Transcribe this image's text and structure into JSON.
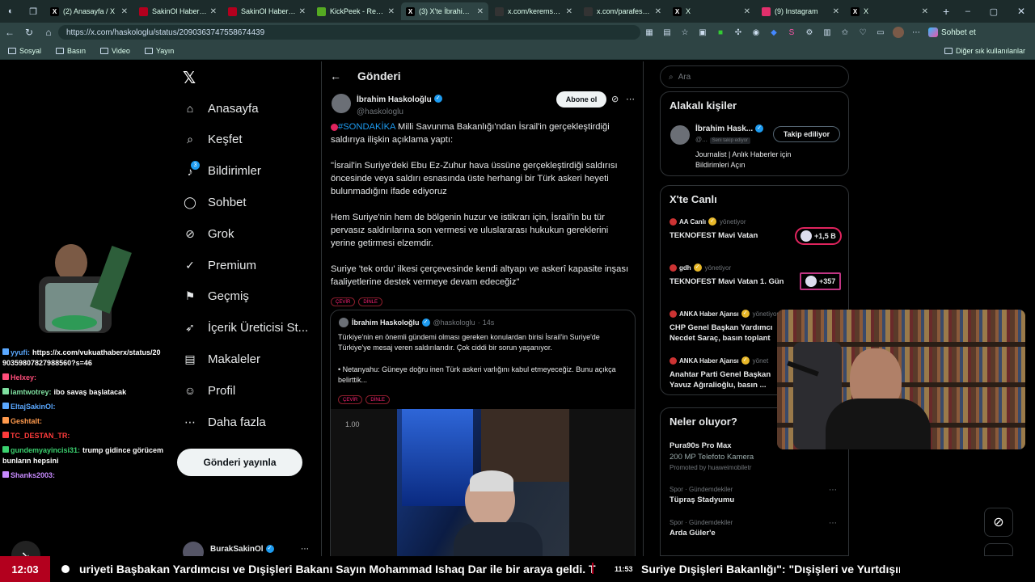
{
  "browser": {
    "tabs": [
      {
        "label": "(2) Anasayfa / X",
        "icon": "x-logo-icon"
      },
      {
        "label": "SakinOl Haber Merk",
        "icon": "tab-favicon"
      },
      {
        "label": "SakinOl Haber Merk",
        "icon": "tab-favicon"
      },
      {
        "label": "KickPeek - Real-time",
        "icon": "tab-favicon"
      },
      {
        "label": "(3) X'te İbrahim Has",
        "icon": "x-logo-icon",
        "active": true
      },
      {
        "label": "x.com/keremsackay",
        "icon": "tab-favicon"
      },
      {
        "label": "x.com/parafesorfina",
        "icon": "tab-favicon"
      },
      {
        "label": "X",
        "icon": "x-logo-icon"
      },
      {
        "label": "(9) Instagram",
        "icon": "instagram-icon"
      },
      {
        "label": "X",
        "icon": "x-logo-icon"
      }
    ],
    "url": "https://x.com/haskologlu/status/2090363747558674439",
    "profile_label": "Sohbet et",
    "bookmarks": [
      "Sosyal",
      "Basın",
      "Video",
      "Yayın"
    ],
    "other_bookmarks": "Diğer sık kullanılanlar"
  },
  "sidebar": {
    "items": [
      {
        "label": "Anasayfa",
        "icon": "home-icon"
      },
      {
        "label": "Keşfet",
        "icon": "search-icon"
      },
      {
        "label": "Bildirimler",
        "icon": "bell-icon",
        "badge": "3"
      },
      {
        "label": "Sohbet",
        "icon": "chat-icon"
      },
      {
        "label": "Grok",
        "icon": "grok-icon"
      },
      {
        "label": "Premium",
        "icon": "premium-icon"
      },
      {
        "label": "Geçmiş",
        "icon": "bookmark-icon"
      },
      {
        "label": "İçerik Üreticisi St...",
        "icon": "rocket-icon"
      },
      {
        "label": "Makaleler",
        "icon": "article-icon"
      },
      {
        "label": "Profil",
        "icon": "person-icon"
      },
      {
        "label": "Daha fazla",
        "icon": "more-icon"
      }
    ],
    "post_button": "Gönderi yayınla",
    "account_name": "BurakSakinOl"
  },
  "main": {
    "header_title": "Gönderi",
    "author_name": "İbrahim Haskoloğlu",
    "author_handle": "@haskologlu",
    "subscribe_label": "Abone ol",
    "hashtag": "#SONDAKİKA",
    "paragraph1": "Milli Savunma Bakanlığı'ndan İsrail'in gerçekleştirdiği saldırıya ilişkin açıklama yaptı:",
    "paragraph2": "\"İsrail'in Suriye'deki Ebu Ez-Zuhur hava üssüne gerçekleştirdiği saldırısı öncesinde veya saldırı esnasında üste herhangi bir Türk askeri heyeti bulunmadığını ifade ediyoruz",
    "paragraph3": "Hem Suriye'nin hem de bölgenin huzur ve istikrarı için, İsrail'in bu tür pervasız saldırılarına son vermesi ve uluslararası hukukun gereklerini yerine getirmesi elzemdir.",
    "paragraph4": "Suriye 'tek ordu' ilkesi çerçevesinde kendi altyapı ve askerî kapasite inşası faaliyetlerine destek vermeye devam edeceğiz\"",
    "pill_translate": "ÇEVİR",
    "pill_listen": "DİNLE",
    "quote": {
      "author": "İbrahim Haskoloğlu",
      "handle": "@haskologlu",
      "time": "14s",
      "text1": "Türkiye'nin en önemli gündemi olması gereken konulardan birisi İsrail'in Suriye'de Türkiye'ye mesaj veren saldırılarıdır. Çok ciddi bir sorun yaşanıyor.",
      "text2": "• Netanyahu:  Güneye doğru inen Türk askeri varlığını kabul etmeyeceğiz. Bunu açıkça belirttik...",
      "video_time": "1.00"
    }
  },
  "right": {
    "search_placeholder": "Ara",
    "related_title": "Alakalı kişiler",
    "related_name": "İbrahim Hask...",
    "related_handle": "@...",
    "related_follows": "Seni takip ediyor",
    "related_follow_btn": "Takip ediliyor",
    "related_bio": "Journalist | Anlık Haberler için Bildirimleri Açın",
    "live_title": "X'te Canlı",
    "live": [
      {
        "host": "AA Canlı",
        "status": "yönetiyor",
        "title": "TEKNOFEST Mavi Vatan",
        "count": "+1,5 B"
      },
      {
        "host": "gdh",
        "status": "yönetiyor",
        "title": "TEKNOFEST Mavi Vatan 1. Gün",
        "count": "+357"
      },
      {
        "host": "ANKA Haber Ajansı",
        "status": "yönetiyor",
        "title": "CHP Genel Başkan Yardımcı Necdet Saraç, basın toplant",
        "count": ""
      },
      {
        "host": "ANKA Haber Ajansı",
        "status": "yönet",
        "title": "Anahtar Parti Genel Başkan Yavuz Ağıralioğlu, basın ...",
        "count": ""
      }
    ],
    "whats_title": "Neler oluyor?",
    "trends": [
      {
        "meta": "",
        "name": "Pura90s Pro Max",
        "sub": "200 MP Telefoto Kamera",
        "promo": "Promoted by huaweimobiletr"
      },
      {
        "meta": "Spor · Gündemdekiler",
        "name": "Tüpraş Stadyumu",
        "sub": "",
        "promo": ""
      },
      {
        "meta": "Spor · Gündemdekiler",
        "name": "Arda Güler'e",
        "sub": "",
        "promo": ""
      }
    ]
  },
  "chat": [
    {
      "user": "yyufi:",
      "text": "https://x.com/vukuathaberx/status/2090359807827988560?s=46",
      "color": "#5aa8ff"
    },
    {
      "user": "Helxey:",
      "text": "",
      "color": "#ff4d7a"
    },
    {
      "user": "iamtwotrey:",
      "text": "ibo savaş başlatacak",
      "color": "#7fe0a0"
    },
    {
      "user": "EltajSakinOl:",
      "text": "",
      "color": "#5aa8ff"
    },
    {
      "user": "Geshtalt:",
      "text": "",
      "color": "#ff9a4d"
    },
    {
      "user": "TC_DESTAN_TR:",
      "text": "",
      "color": "#ff3b3b"
    },
    {
      "user": "gundemyayincisi31:",
      "text": "trump gidince görücem bunların hepsini",
      "color": "#3bd16f"
    },
    {
      "user": "Shanks2003:",
      "text": "",
      "color": "#c88bff"
    }
  ],
  "ticker": {
    "clock": "12:03",
    "text1": "uriyeti Başbakan Yardımcısı ve Dışişleri Bakanı Sayın Mohammad Ishaq Dar ile bir araya geldi. T",
    "time2": "11:53",
    "text2": "Suriye Dışişleri Bakanlığı\": \"Dışişleri ve Yurtdışınd"
  }
}
